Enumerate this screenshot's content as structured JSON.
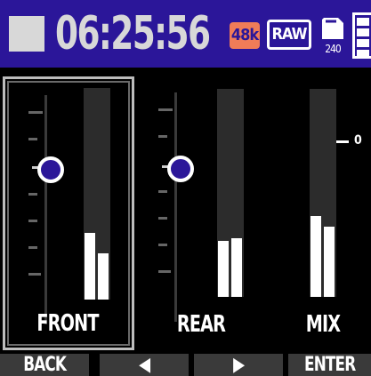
{
  "status": {
    "time": "06:25:56",
    "sample_rate_badge": "48k",
    "format_badge": "RAW",
    "sd_remaining": "240",
    "battery_bars": 4
  },
  "channels": [
    {
      "label": "FRONT",
      "selected": true,
      "meter_levels": [
        0.3,
        0.21
      ]
    },
    {
      "label": "REAR",
      "selected": false,
      "meter_levels": [
        0.26,
        0.27
      ]
    },
    {
      "label": "MIX",
      "selected": false,
      "meter_levels": [
        0.38,
        0.34
      ]
    }
  ],
  "meter_zero_label": "0",
  "softkeys": {
    "back": "BACK",
    "left": "◀",
    "right": "▶",
    "enter": "ENTER"
  },
  "colors": {
    "statusbar": "#2b1699",
    "rate_badge": "#f07c58",
    "knob_fill": "#2b1699"
  }
}
